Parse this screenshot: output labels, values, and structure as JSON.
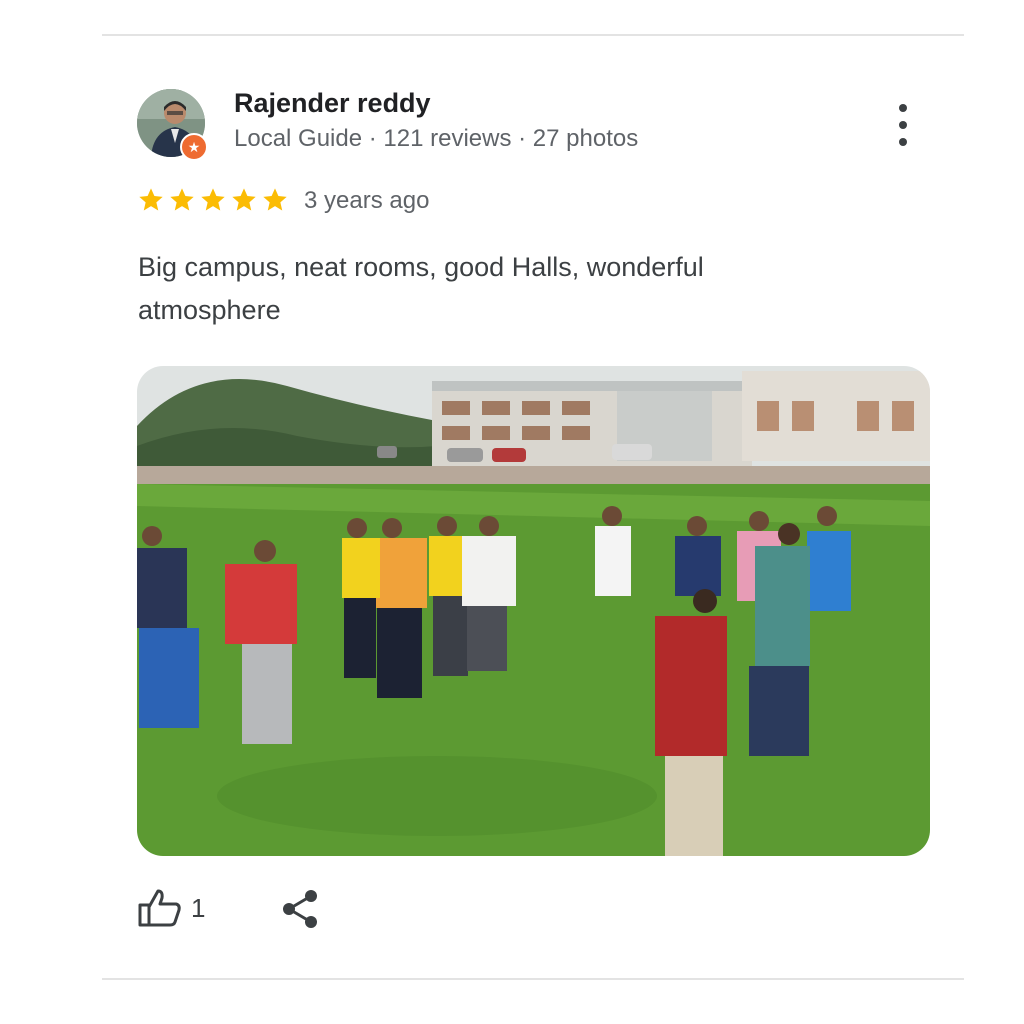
{
  "review": {
    "author": {
      "name": "Rajender reddy",
      "subline": "Local Guide · 121 reviews · 27 photos",
      "avatar_icon": "local-guide-badge-icon"
    },
    "rating": 5,
    "rating_max": 5,
    "time_ago": "3 years ago",
    "text": "Big campus, neat rooms, good Halls, wonderful atmosphere",
    "photo_icon": "group-photo-campus",
    "like_count": "1"
  },
  "colors": {
    "star": "#fbbc04",
    "badge": "#ee6b31",
    "grass": "#5c9a32",
    "sky": "#dfe3e2"
  }
}
